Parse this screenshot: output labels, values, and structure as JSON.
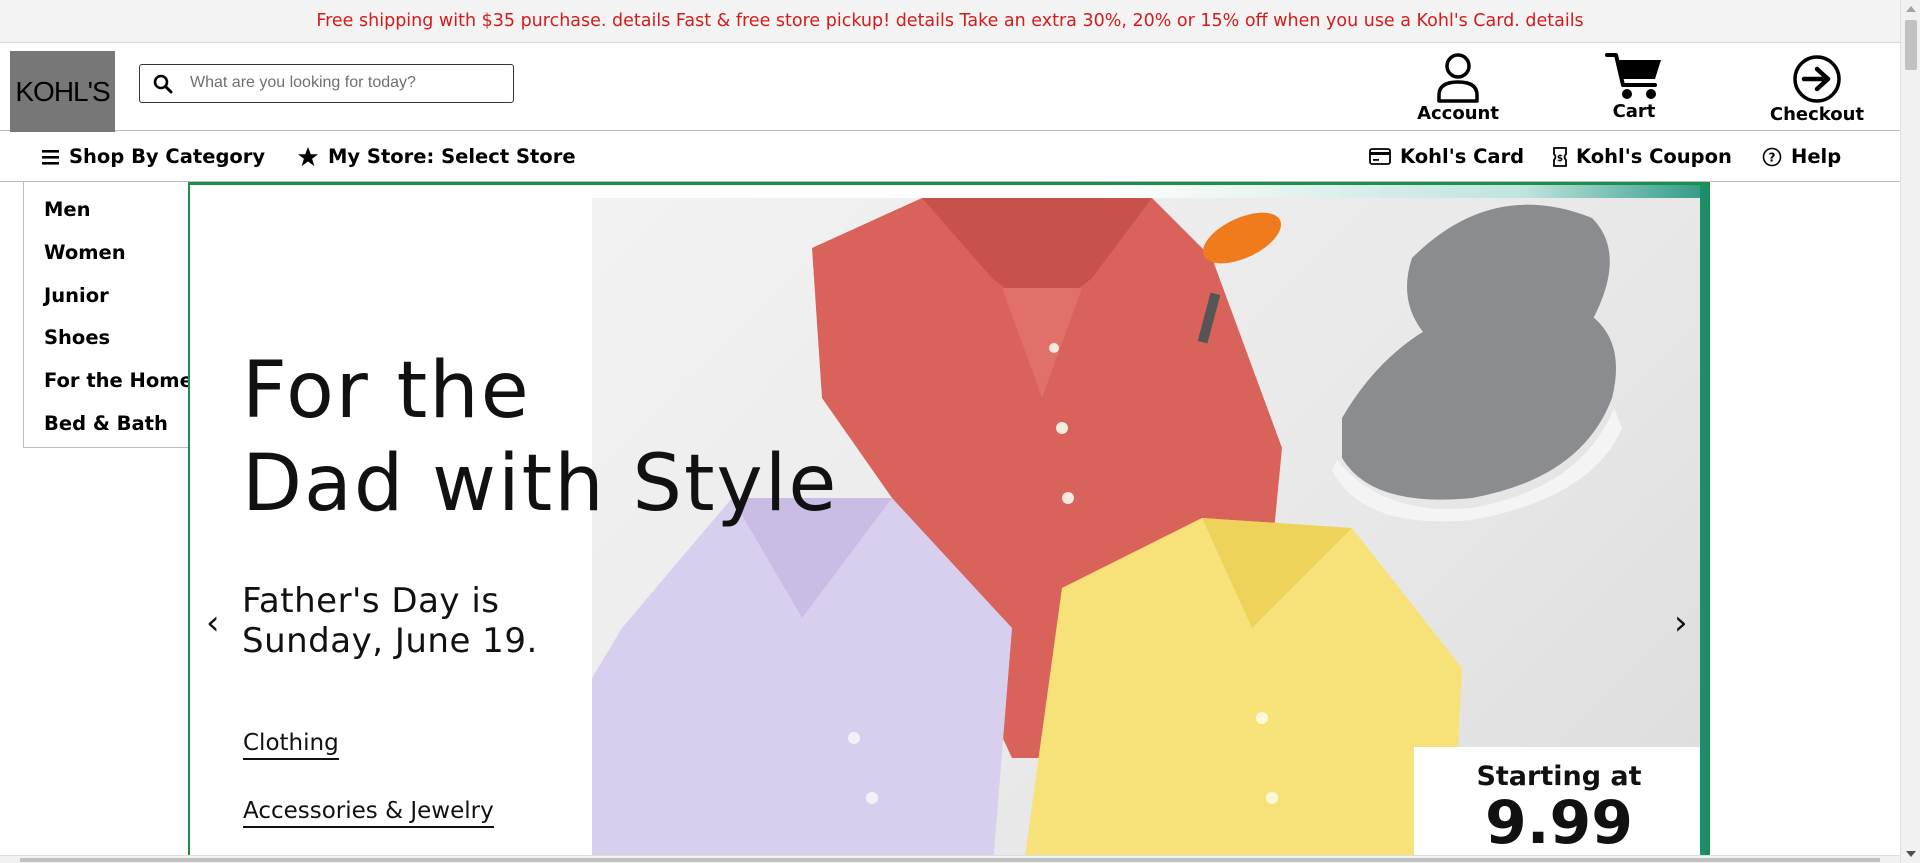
{
  "promo": {
    "text": "Free shipping with $35 purchase. details Fast & free store pickup! details Take an extra 30%, 20% or 15% off when you use a Kohl's Card. details"
  },
  "header": {
    "logo": "KOHL'S",
    "search_placeholder": "What are you looking for today?",
    "account_label": "Account",
    "cart_label": "Cart",
    "checkout_label": "Checkout"
  },
  "nav": {
    "shop_by_category": "Shop By Category",
    "my_store": "My Store: Select Store",
    "kohls_card": "Kohl's Card",
    "kohls_coupon": "Kohl's Coupon",
    "help": "Help"
  },
  "category_menu": [
    "Men",
    "Women",
    "Junior",
    "Shoes",
    "For the Home",
    "Bed & Bath"
  ],
  "hero": {
    "headline_line1": "For the",
    "headline_line2": "Dad with Style",
    "sub_line1": "Father's Day is",
    "sub_line2": "Sunday, June 19.",
    "links": [
      "Clothing",
      "Accessories & Jewelry"
    ],
    "price_label": "Starting at",
    "price_value": "9.99",
    "prev_arrow": "‹",
    "next_arrow": "›"
  },
  "icons": {
    "search": "search-icon",
    "account": "user-icon",
    "cart": "cart-icon",
    "checkout": "arrow-circle-right-icon",
    "menu": "hamburger-icon",
    "store": "star-icon",
    "card": "credit-card-icon",
    "coupon": "coupon-icon",
    "help": "question-circle-icon"
  },
  "colors": {
    "promo_text": "#d21c1c",
    "hero_border": "#1c8f4d",
    "shirt_red": "#d9625a",
    "shirt_lilac": "#d8cfee",
    "shirt_yellow": "#f7e27a",
    "shoe_gray": "#8a8c90",
    "keychain_orange": "#f07b1c"
  }
}
